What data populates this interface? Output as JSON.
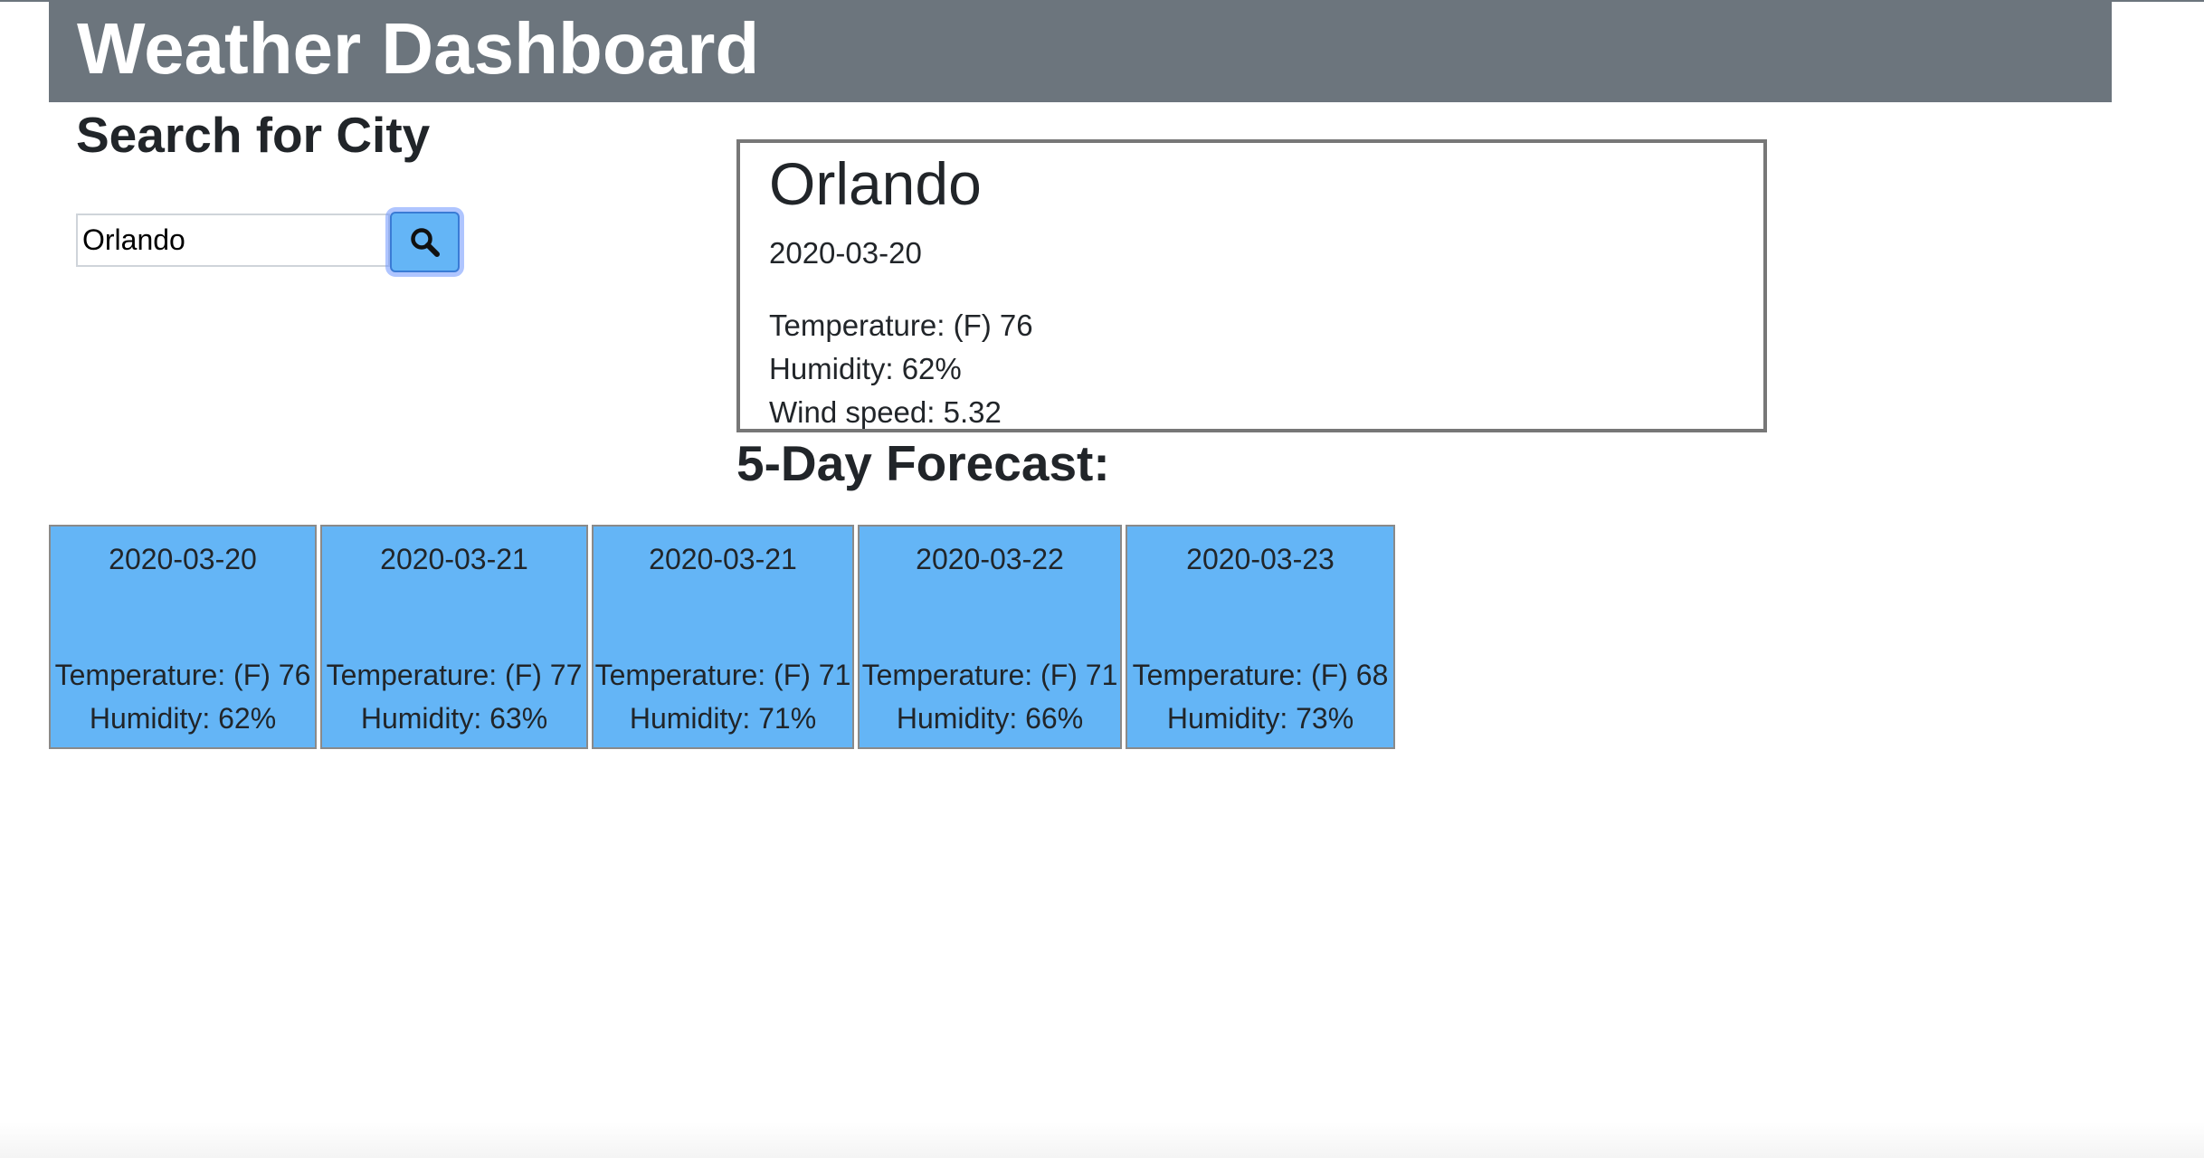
{
  "header": {
    "title": "Weather Dashboard"
  },
  "search": {
    "title": "Search for City",
    "input_value": "Orlando",
    "button_icon": "search-icon"
  },
  "current": {
    "city": "Orlando",
    "date": "2020-03-20",
    "temperature": "Temperature: (F) 76",
    "humidity": "Humidity: 62%",
    "wind": "Wind speed: 5.32"
  },
  "forecast": {
    "title": "5-Day Forecast:",
    "days": [
      {
        "date": "2020-03-20",
        "temperature": "Temperature: (F) 76",
        "humidity": "Humidity: 62%"
      },
      {
        "date": "2020-03-21",
        "temperature": "Temperature: (F) 77",
        "humidity": "Humidity: 63%"
      },
      {
        "date": "2020-03-21",
        "temperature": "Temperature: (F) 71",
        "humidity": "Humidity: 71%"
      },
      {
        "date": "2020-03-22",
        "temperature": "Temperature: (F) 71",
        "humidity": "Humidity: 66%"
      },
      {
        "date": "2020-03-23",
        "temperature": "Temperature: (F) 68",
        "humidity": "Humidity: 73%"
      }
    ]
  },
  "colors": {
    "header_bg": "#6c757d",
    "card_bg": "#64b5f6",
    "button_bg": "#64b5f6",
    "text": "#212529"
  }
}
